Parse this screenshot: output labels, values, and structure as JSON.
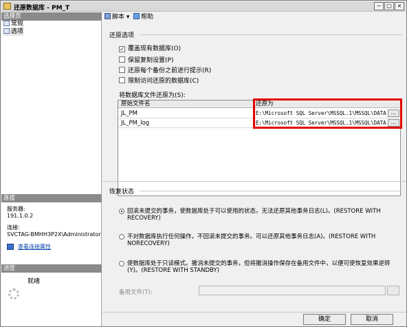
{
  "window": {
    "title": "还原数据库 - PM_T"
  },
  "left_panel": {
    "select_page_header": "选择页",
    "pages": [
      {
        "label": "常规"
      },
      {
        "label": "选项"
      }
    ],
    "connection_header": "连接",
    "server_label": "服务器:",
    "server_value": "191.1.0.2",
    "connection_label": "连接:",
    "connection_value": "SVCTAG-BMHH3P2X\\Administrator",
    "view_link": "查看连接属性",
    "progress_header": "进度",
    "progress_status": "就绪"
  },
  "toolbar": {
    "script_label": "脚本",
    "help_label": "帮助"
  },
  "restore_options": {
    "section_title": "还原选项",
    "checkboxes": [
      {
        "label": "覆盖现有数据库(O)",
        "checked": true
      },
      {
        "label": "保留复制设置(P)",
        "checked": false
      },
      {
        "label": "还原每个备份之前进行提示(R)",
        "checked": false
      },
      {
        "label": "限制访问还原的数据库(C)",
        "checked": false
      }
    ],
    "files_label": "将数据库文件还原为(S):",
    "table": {
      "headers": [
        "原始文件名",
        "还原为"
      ],
      "rows": [
        {
          "name": "JL_PM",
          "path": "E:\\Microsoft SQL Server\\MSSQL.1\\MSSQL\\DATA\\J..."
        },
        {
          "name": "JL_PM_log",
          "path": "E:\\Microsoft SQL Server\\MSSQL.1\\MSSQL\\DATA\\J..."
        }
      ],
      "ellipsis": "..."
    }
  },
  "recovery": {
    "section_title": "恢复状态",
    "options": [
      {
        "text": "回滚未提交的事务，使数据库处于可以使用的状态。无法还原其他事务日志(L)。(RESTORE WITH RECOVERY)",
        "selected": true
      },
      {
        "text": "不对数据库执行任何操作，不回滚未提交的事务。可以还原其他事务日志(A)。(RESTORE WITH NORECOVERY)",
        "selected": false
      },
      {
        "text": "使数据库处于只读模式。撤消未提交的事务，但将撤消操作保存在备用文件中，以便可使恢复效果逆转(Y)。(RESTORE WITH STANDBY)",
        "selected": false
      }
    ],
    "standby_label": "备用文件(T):"
  },
  "buttons": {
    "ok": "确定",
    "cancel": "取消"
  },
  "colors": {
    "highlight": "#e10000",
    "pane_header": "#8a8a8a",
    "link": "#0645ad"
  }
}
